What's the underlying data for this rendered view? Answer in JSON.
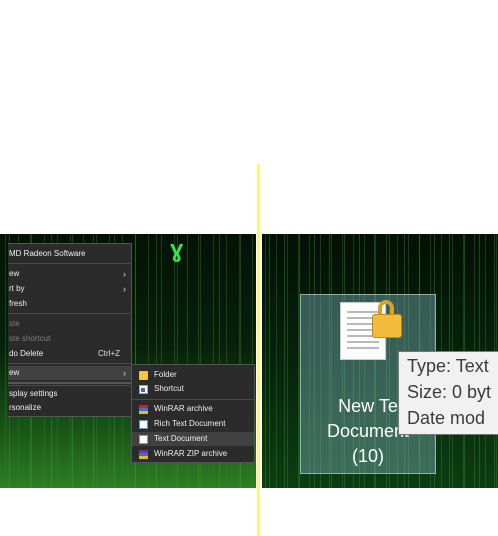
{
  "context_menu": {
    "items": [
      {
        "label": "MD Radeon Software"
      },
      {
        "label": "ew"
      },
      {
        "label": "rt by"
      },
      {
        "label": "fresh"
      },
      {
        "label": "ste"
      },
      {
        "label": "ste shortcut"
      },
      {
        "label": "do Delete",
        "shortcut": "Ctrl+Z"
      },
      {
        "label": "ew"
      },
      {
        "label": "splay settings"
      },
      {
        "label": "rsonalize"
      }
    ],
    "arrow_glyph": "›"
  },
  "new_submenu": {
    "items": [
      {
        "label": "Folder",
        "icon": "folder-icon"
      },
      {
        "label": "Shortcut",
        "icon": "shortcut-icon"
      },
      {
        "label": "WinRAR archive",
        "icon": "winrar-icon"
      },
      {
        "label": "Rich Text Document",
        "icon": "rich-text-icon"
      },
      {
        "label": "Text Document",
        "icon": "text-document-icon"
      },
      {
        "label": "WinRAR ZIP archive",
        "icon": "winrar-zip-icon"
      }
    ]
  },
  "desktop_file": {
    "name_line1": "New Te",
    "name_line2": "Document",
    "name_line3": "(10)",
    "icon": "locked-text-file-icon"
  },
  "tooltip": {
    "type_line": "Type: Text",
    "size_line": "Size: 0 byt",
    "date_line": "Date mod"
  },
  "colors": {
    "menu_bg": "#2b2b2b",
    "divider": "#fff480",
    "tooltip_bg": "#f1f1f1"
  }
}
